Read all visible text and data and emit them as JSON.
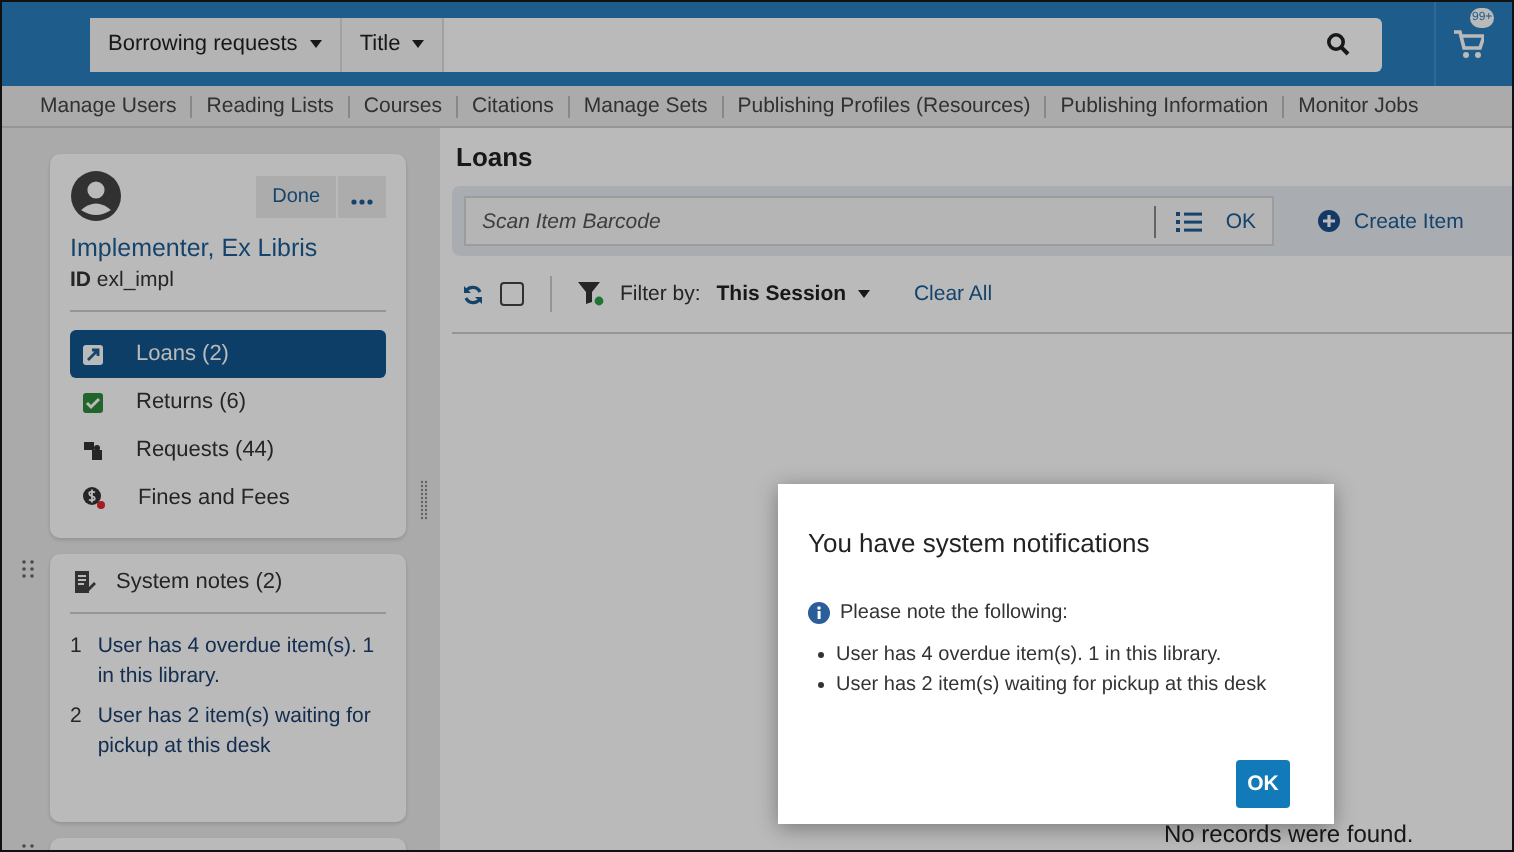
{
  "top_bar": {
    "scope_dropdown": "Borrowing requests",
    "field_dropdown": "Title",
    "cart_badge": "99+"
  },
  "nav_links": [
    "Manage Users",
    "Reading Lists",
    "Courses",
    "Citations",
    "Manage Sets",
    "Publishing Profiles (Resources)",
    "Publishing Information",
    "Monitor Jobs"
  ],
  "user_card": {
    "name": "Implementer, Ex Libris",
    "id_label": "ID",
    "id_value": "exl_impl",
    "done_button": "Done"
  },
  "sections": [
    {
      "label": "Loans (2)",
      "kind": "loans",
      "selected": true
    },
    {
      "label": "Returns (6)",
      "kind": "returns",
      "selected": false
    },
    {
      "label": "Requests (44)",
      "kind": "requests",
      "selected": false
    },
    {
      "label": "Fines and Fees",
      "kind": "fines",
      "selected": false
    }
  ],
  "system_notes": {
    "title": "System notes (2)",
    "notes": [
      {
        "number": "1",
        "text": "User has 4 overdue item(s). 1 in this library."
      },
      {
        "number": "2",
        "text": "User has 2 item(s) waiting for pickup at this desk"
      }
    ]
  },
  "loans": {
    "title": "Loans",
    "barcode_placeholder": "Scan Item Barcode",
    "ok_button": "OK",
    "create_item": "Create Item",
    "select_all_checked": false,
    "filter_label": "Filter by:",
    "filter_value": "This Session",
    "clear_all": "Clear All",
    "empty_message": "No records were found."
  },
  "dialog": {
    "title": "You have system notifications",
    "intro": "Please note the following:",
    "messages": [
      "User has 4 overdue item(s). 1 in this library.",
      "User has 2 item(s) waiting for pickup at this desk"
    ],
    "ok_button": "OK"
  }
}
